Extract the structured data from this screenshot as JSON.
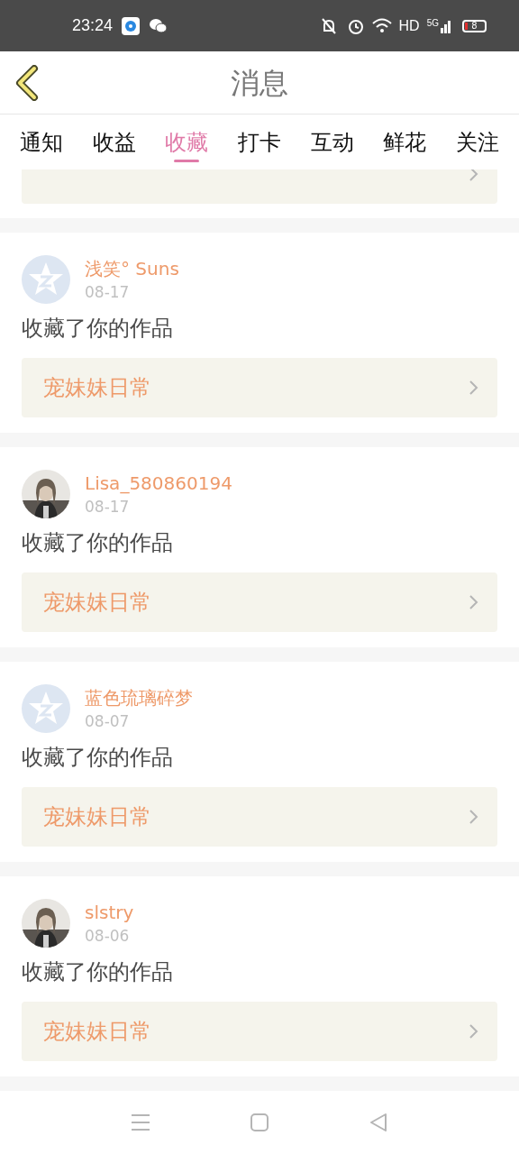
{
  "status_bar": {
    "time": "23:24",
    "network": "HD",
    "cellular": "5G",
    "battery": "8"
  },
  "header": {
    "title": "消息"
  },
  "tabs": [
    {
      "label": "通知",
      "selected": false
    },
    {
      "label": "收益",
      "selected": false
    },
    {
      "label": "收藏",
      "selected": true
    },
    {
      "label": "打卡",
      "selected": false
    },
    {
      "label": "互动",
      "selected": false
    },
    {
      "label": "鲜花",
      "selected": false
    },
    {
      "label": "关注",
      "selected": false
    }
  ],
  "messages": [
    {
      "user": "浅笑° Suns",
      "date": "08-17",
      "avatar": {
        "kind": "default"
      },
      "text": "收藏了你的作品",
      "work_title": "宠妹妹日常"
    },
    {
      "user": "Lisa_580860194",
      "date": "08-17",
      "text": "收藏了你的作品",
      "work_title": "宠妹妹日常"
    },
    {
      "user": "蓝色琉璃碎梦",
      "date": "08-07",
      "avatar": {
        "kind": "default"
      },
      "text": "收藏了你的作品",
      "work_title": "宠妹妹日常"
    },
    {
      "user": "slstry",
      "date": "08-06",
      "text": "收藏了你的作品",
      "work_title": "宠妹妹日常"
    }
  ]
}
